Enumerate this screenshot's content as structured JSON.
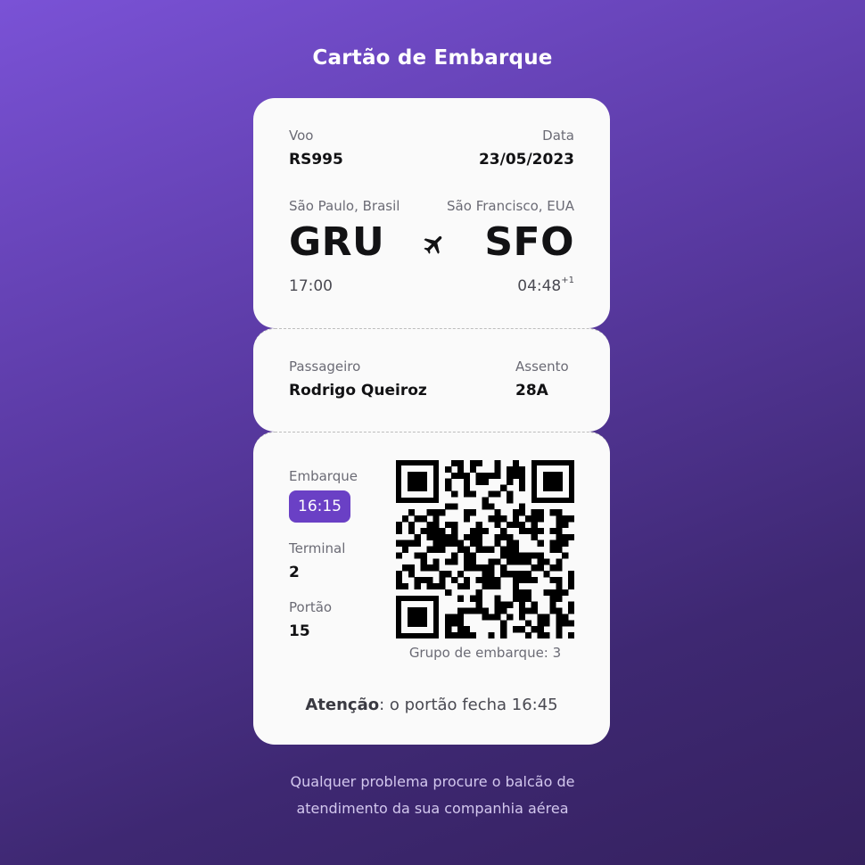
{
  "page": {
    "title": "Cartão de Embarque",
    "footer_line1": "Qualquer problema procure o balcão de",
    "footer_line2": "atendimento da sua companhia aérea"
  },
  "flight": {
    "flight_label": "Voo",
    "flight_number": "RS995",
    "date_label": "Data",
    "date": "23/05/2023",
    "origin_city": "São Paulo, Brasil",
    "destination_city": "São Francisco, EUA",
    "origin_code": "GRU",
    "destination_code": "SFO",
    "departure_time": "17:00",
    "arrival_time": "04:48",
    "arrival_day_offset": "+1",
    "icon": "airplane-icon"
  },
  "passenger": {
    "name_label": "Passageiro",
    "name": "Rodrigo Queiroz",
    "seat_label": "Assento",
    "seat": "28A"
  },
  "boarding": {
    "boarding_label": "Embarque",
    "boarding_time": "16:15",
    "terminal_label": "Terminal",
    "terminal": "2",
    "gate_label": "Portão",
    "gate": "15",
    "group_text": "Grupo de embarque: 3",
    "notice_strong": "Atenção",
    "notice_text": ": o portão fecha 16:45"
  },
  "colors": {
    "accent": "#6a40c5",
    "background_top": "#7a52d6",
    "background_bottom": "#35215f",
    "card": "#fafafa"
  }
}
